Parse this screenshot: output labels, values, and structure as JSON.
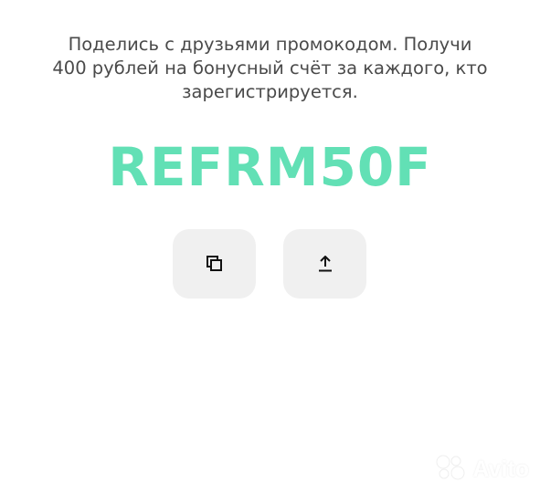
{
  "referral": {
    "description_lines": [
      "Поделись с друзьями промокодом. Получи",
      "400 рублей на бонусный счёт за каждого, кто",
      "зарегистрируется."
    ],
    "promo_code": "REFRM50F"
  },
  "actions": {
    "copy_icon": "copy-icon",
    "share_icon": "share-upload-icon"
  },
  "watermark": {
    "text": "Avito",
    "logo": "avito-logo"
  },
  "colors": {
    "promo_code": "#62e0b5",
    "text": "#4a4a4a",
    "button_bg": "#f0f0f0",
    "icon": "#111111"
  }
}
